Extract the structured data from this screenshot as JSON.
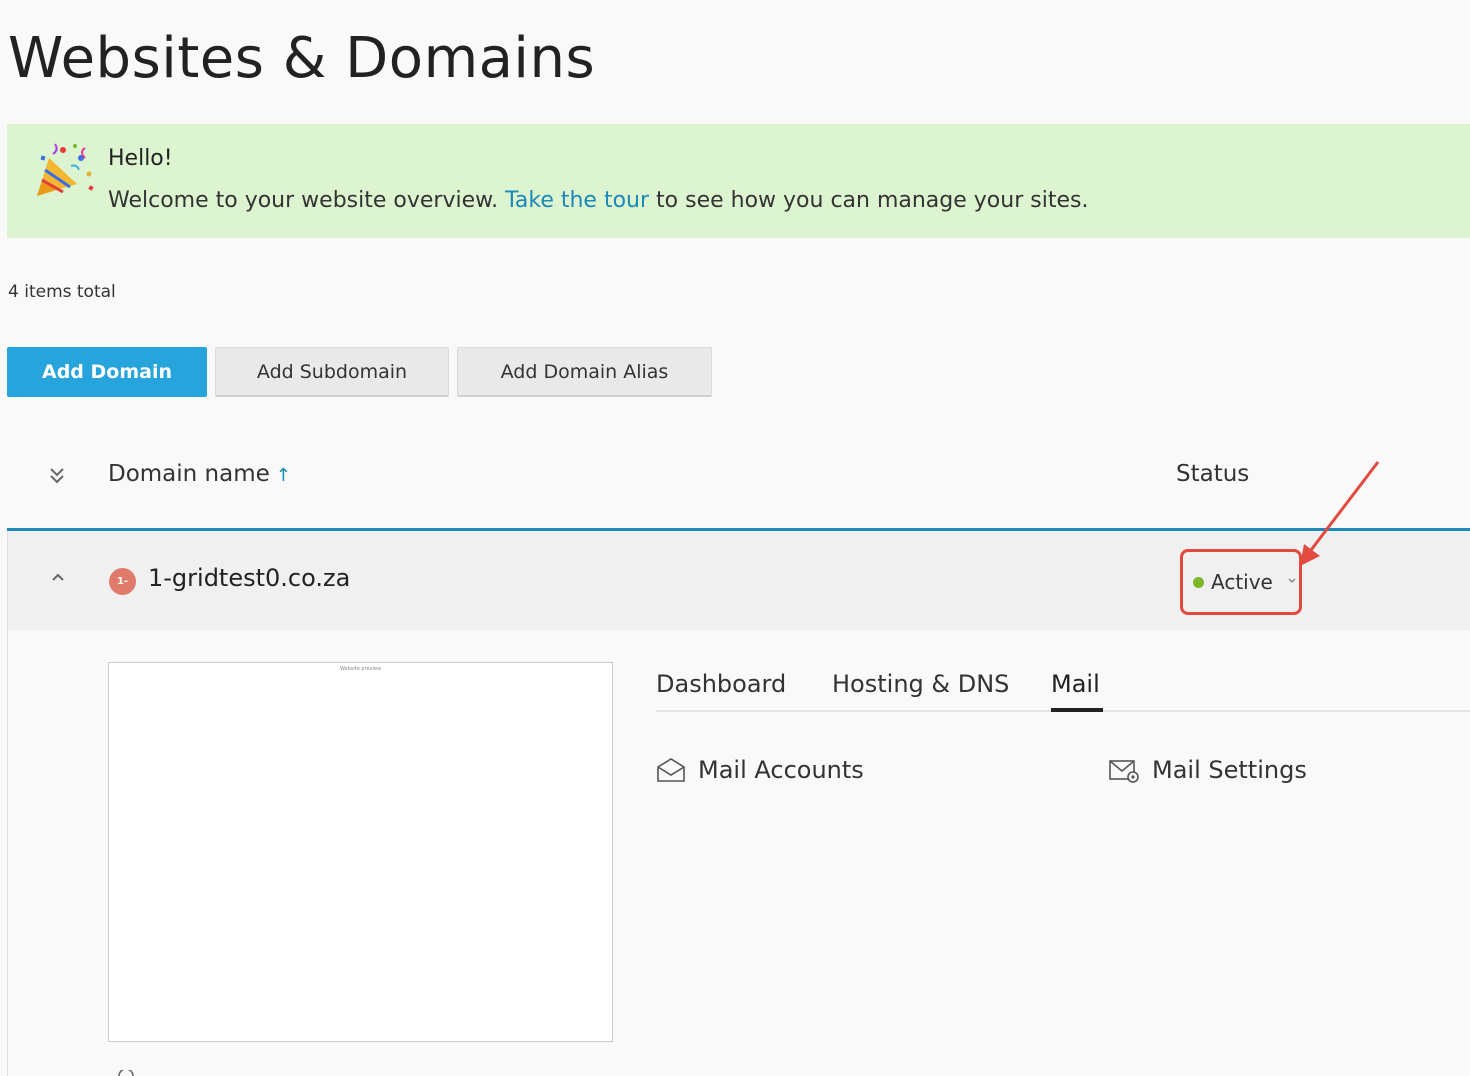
{
  "page": {
    "title": "Websites & Domains"
  },
  "banner": {
    "title": "Hello!",
    "text_before": "Welcome to your website overview.",
    "link_text": "Take the tour",
    "text_after": "to see how you can manage your sites.",
    "icon": "party-popper-icon"
  },
  "list": {
    "items_total": "4 items total",
    "buttons": {
      "add_domain": "Add Domain",
      "add_subdomain": "Add Subdomain",
      "add_alias": "Add Domain Alias"
    },
    "columns": {
      "domain_name": "Domain name",
      "sort_arrow": "↑",
      "status": "Status"
    }
  },
  "row": {
    "badge": "1-",
    "domain": "1-gridtest0.co.za",
    "status": "Active"
  },
  "details": {
    "preview_caption": "Website preview",
    "tabs": [
      "Dashboard",
      "Hosting & DNS",
      "Mail"
    ],
    "active_tab": "Mail",
    "links": {
      "mail_accounts": "Mail Accounts",
      "mail_settings": "Mail Settings"
    }
  },
  "colors": {
    "primary": "#28a4dc",
    "link": "#1b89b8",
    "banner_bg": "#ddf4d0",
    "status_active": "#7ab829",
    "annotation": "#e2493f"
  }
}
